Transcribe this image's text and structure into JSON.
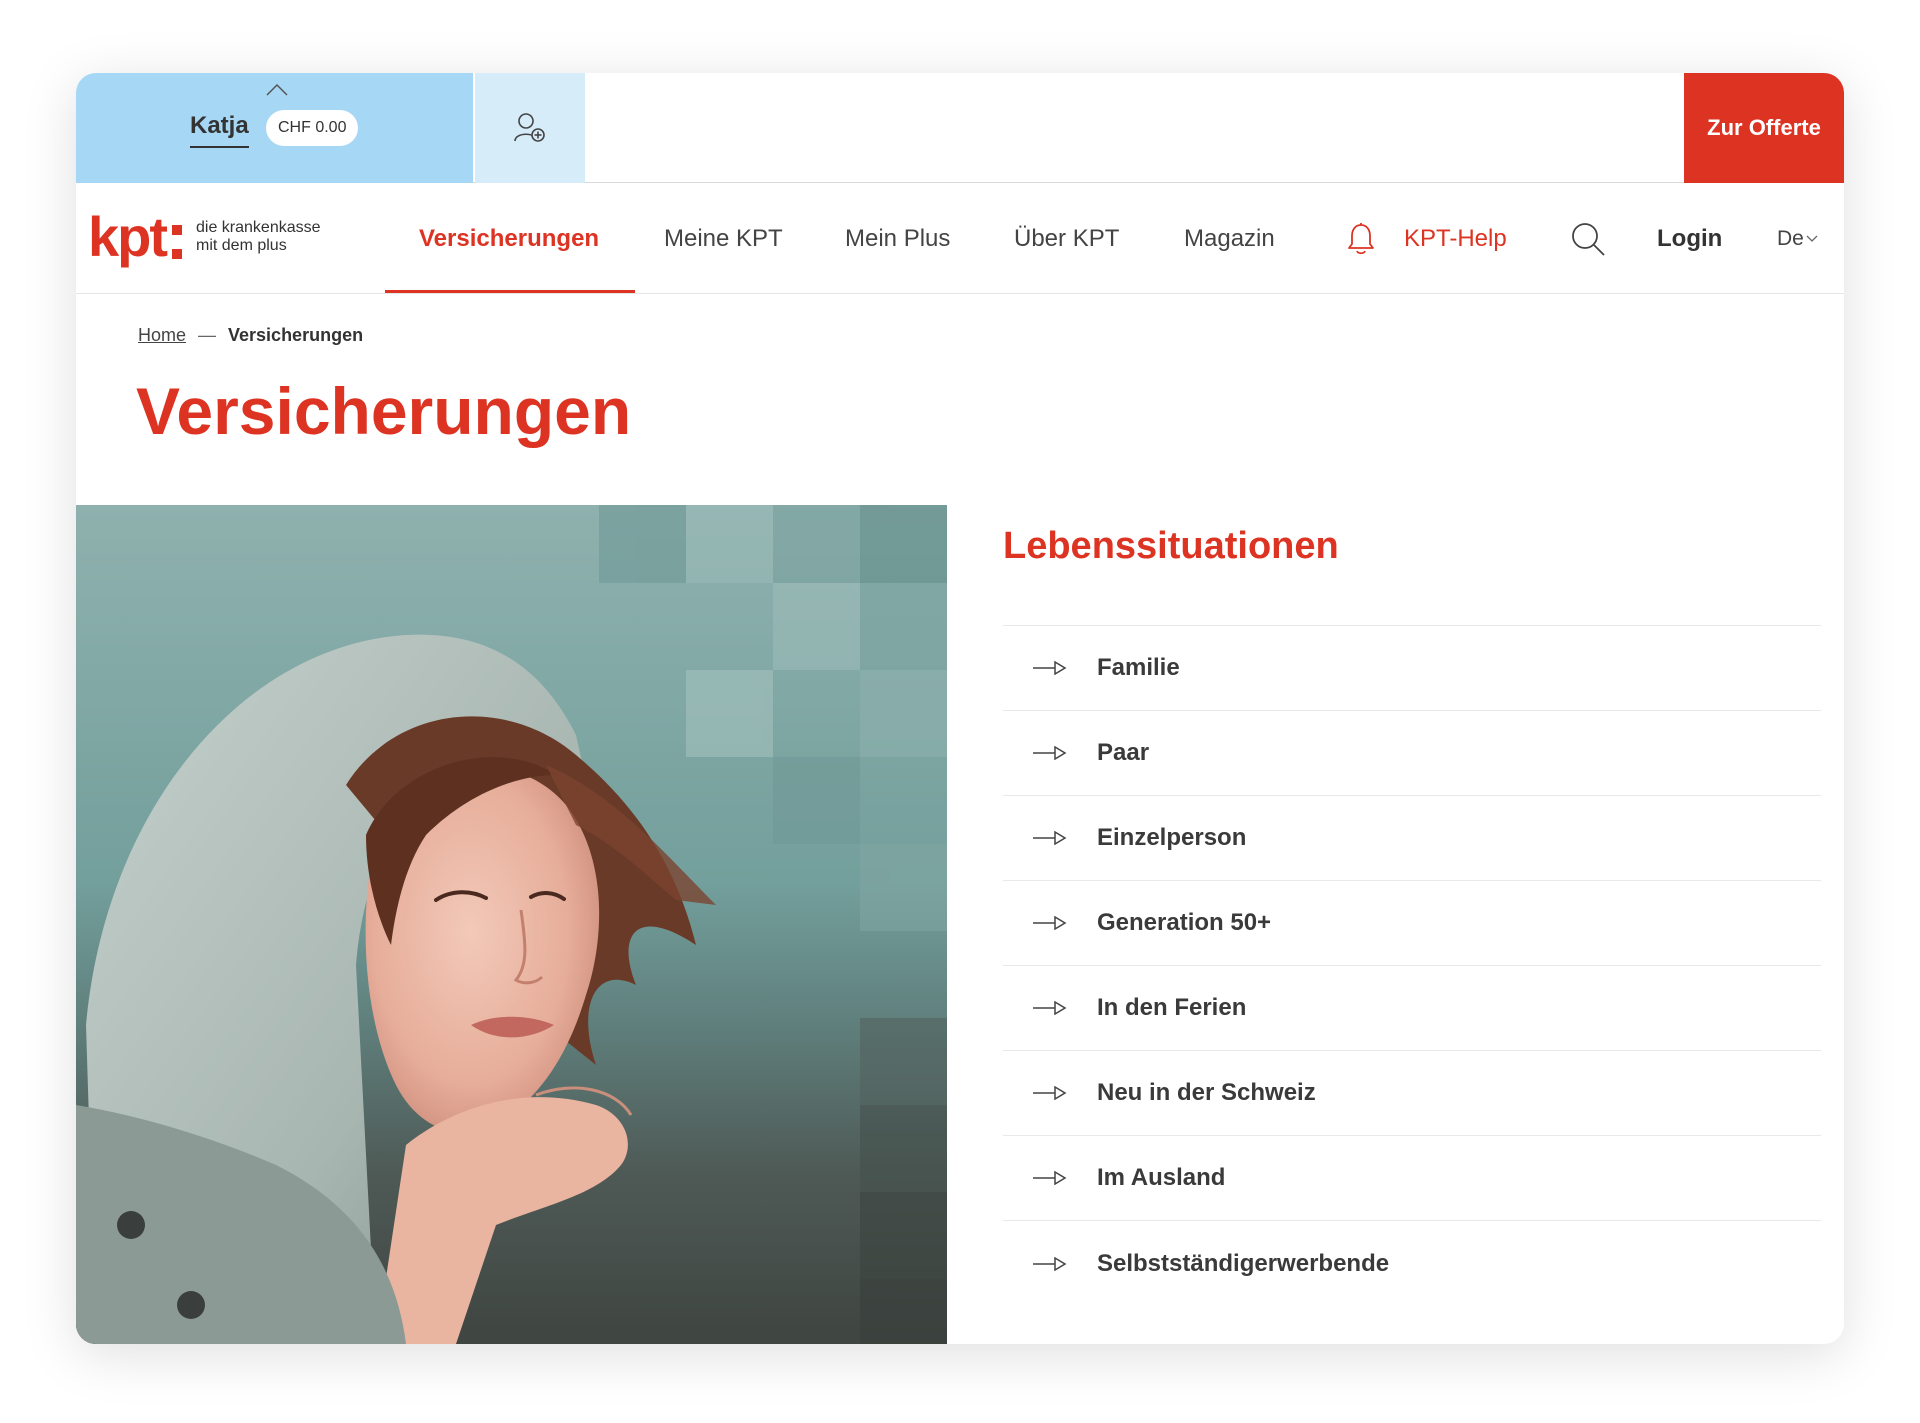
{
  "topbar": {
    "profile_name": "Katja",
    "chf_balance": "CHF  0.00",
    "offer_label": "Zur Offerte"
  },
  "logo": {
    "mark": "kpt",
    "tagline_line1": "die krankenkasse",
    "tagline_line2": "mit dem plus"
  },
  "nav": {
    "items": [
      {
        "label": "Versicherungen",
        "active": true
      },
      {
        "label": "Meine KPT"
      },
      {
        "label": "Mein Plus"
      },
      {
        "label": "Über KPT"
      },
      {
        "label": "Magazin"
      }
    ],
    "help_label": "KPT-Help",
    "login_label": "Login",
    "language": "De"
  },
  "breadcrumb": {
    "home": "Home",
    "separator": "—",
    "current": "Versicherungen"
  },
  "page": {
    "title": "Versicherungen"
  },
  "situations": {
    "title": "Lebenssituationen",
    "items": [
      "Familie",
      "Paar",
      "Einzelperson",
      "Generation 50+",
      "In den Ferien",
      "Neu in der Schweiz",
      "Im Ausland",
      "Selbstständigerwerbende"
    ]
  },
  "colors": {
    "brand_red": "#dd3323",
    "profile_blue": "#a6d7f4",
    "profile_blue_light": "#d7ecf9"
  }
}
